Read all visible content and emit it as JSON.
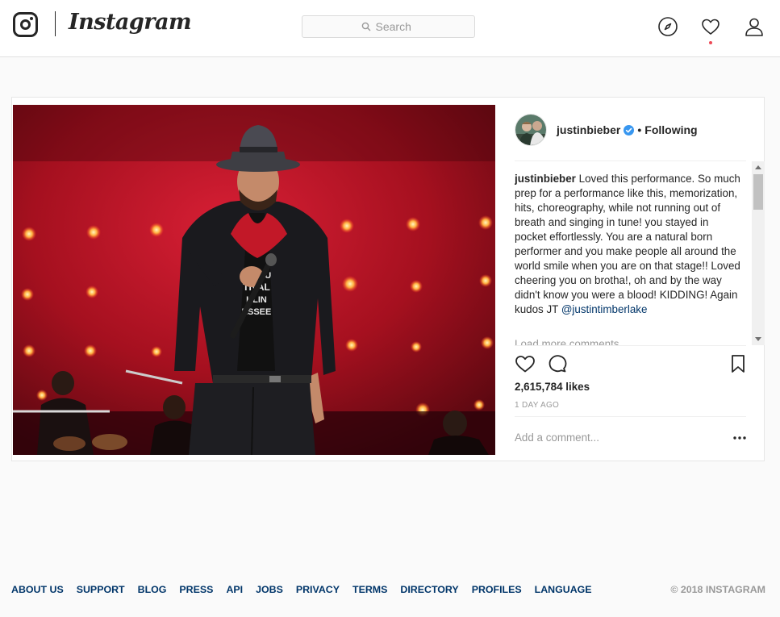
{
  "header": {
    "wordmark": "Instagram",
    "search_placeholder": "Search",
    "icons": [
      "instagram-glyph-icon",
      "search-icon",
      "compass-icon",
      "heart-icon",
      "user-icon"
    ]
  },
  "post": {
    "username": "justinbieber",
    "separator": "•",
    "follow_status": "Following",
    "caption": {
      "username": "justinbieber",
      "text": " Loved this performance. So much prep for a performance like this, memorization, hits, choreography, while not running out of breath and singing in tune! you stayed in pocket effortlessly. You are a natural born performer and you make people all around the world smile when you are on that stage!! Loved cheering you on brotha!, oh and by the way didn't know you were a blood! KIDDING! Again kudos JT ",
      "mention": "@justintimberlake"
    },
    "load_more": "Load more comments",
    "likes": "2,615,784 likes",
    "time_ago": "1 DAY AGO",
    "comment_placeholder": "Add a comment...",
    "action_icons": [
      "heart-outline-icon",
      "comment-icon",
      "bookmark-icon",
      "more-horizontal-icon"
    ]
  },
  "colors": {
    "link": "#003569",
    "verified": "#3897f0",
    "notification": "#ed4956",
    "muted": "#999999"
  },
  "footer": {
    "links": [
      "ABOUT US",
      "SUPPORT",
      "BLOG",
      "PRESS",
      "API",
      "JOBS",
      "PRIVACY",
      "TERMS",
      "DIRECTORY",
      "PROFILES",
      "LANGUAGE"
    ],
    "copyright": "© 2018 INSTAGRAM"
  }
}
